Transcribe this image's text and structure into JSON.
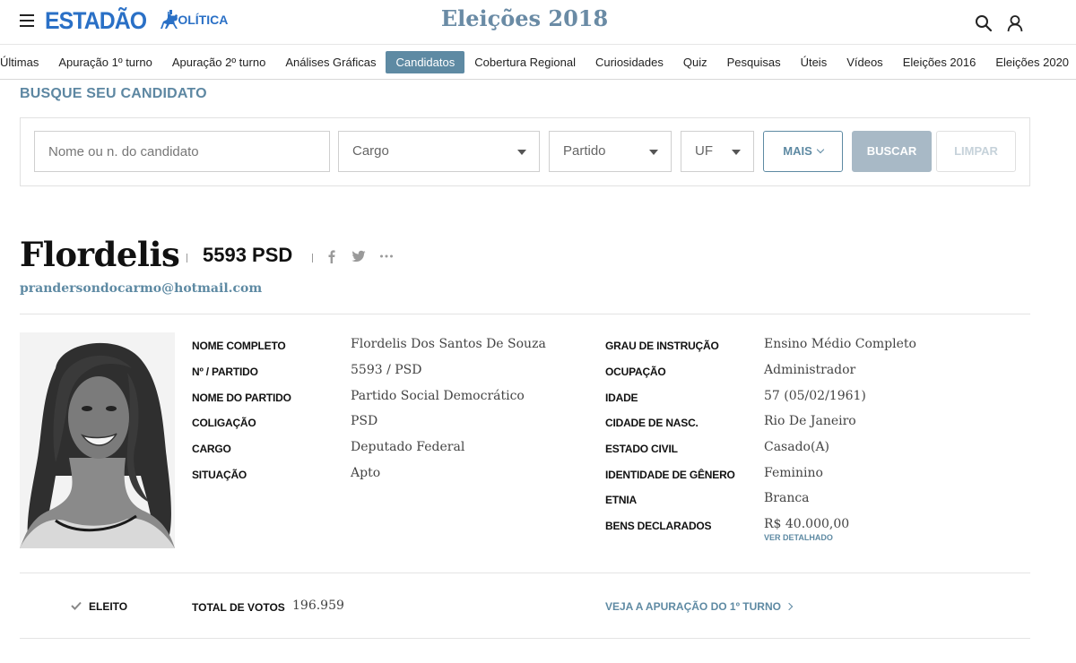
{
  "header": {
    "logo_text": "ESTADÃO",
    "section": "POLÍTICA",
    "title": "Eleições 2018",
    "icons": [
      "menu-icon",
      "horse-rider-logo-icon",
      "search-icon",
      "user-icon"
    ]
  },
  "nav": {
    "items": [
      {
        "label": "Últimas"
      },
      {
        "label": "Apuração 1º turno"
      },
      {
        "label": "Apuração 2º turno"
      },
      {
        "label": "Análises Gráficas"
      },
      {
        "label": "Candidatos",
        "active": true
      },
      {
        "label": "Cobertura Regional"
      },
      {
        "label": "Curiosidades"
      },
      {
        "label": "Quiz"
      },
      {
        "label": "Pesquisas"
      },
      {
        "label": "Úteis"
      },
      {
        "label": "Vídeos"
      },
      {
        "label": "Eleições 2016"
      },
      {
        "label": "Eleições 2020"
      }
    ]
  },
  "search": {
    "heading": "BUSQUE SEU CANDIDATO",
    "name_placeholder": "Nome ou n. do candidato",
    "name_value": "",
    "cargo": "Cargo",
    "partido": "Partido",
    "uf": "UF",
    "more_label": "MAIS",
    "search_label": "BUSCAR",
    "clear_label": "LIMPAR"
  },
  "candidate": {
    "name": "Flordelis",
    "number_party": "5593 PSD",
    "email": "prandersondocarmo@hotmail.com",
    "share_icons": [
      "facebook-icon",
      "twitter-icon",
      "more-icon"
    ],
    "details_left": [
      {
        "label": "NOME COMPLETO",
        "value": "Flordelis Dos Santos De Souza"
      },
      {
        "label": "Nº / PARTIDO",
        "value": "5593 / PSD"
      },
      {
        "label": "NOME DO PARTIDO",
        "value": "Partido Social Democrático"
      },
      {
        "label": "COLIGAÇÃO",
        "value": "PSD"
      },
      {
        "label": "CARGO",
        "value": "Deputado Federal"
      },
      {
        "label": "SITUAÇÃO",
        "value": "Apto"
      }
    ],
    "details_right": [
      {
        "label": "GRAU DE INSTRUÇÃO",
        "value": "Ensino Médio Completo"
      },
      {
        "label": "OCUPAÇÃO",
        "value": "Administrador"
      },
      {
        "label": "IDADE",
        "value": "57 (05/02/1961)"
      },
      {
        "label": "CIDADE DE NASC.",
        "value": "Rio De Janeiro"
      },
      {
        "label": "ESTADO CIVIL",
        "value": "Casado(A)"
      },
      {
        "label": "IDENTIDADE DE GÊNERO",
        "value": "Feminino"
      },
      {
        "label": "ETNIA",
        "value": "Branca"
      },
      {
        "label": "BENS DECLARADOS",
        "value": "R$ 40.000,00"
      }
    ],
    "assets_link": "VER DETALHADO"
  },
  "result": {
    "status": "ELEITO",
    "total_votes_label": "TOTAL DE VOTOS",
    "total_votes": "196.959",
    "apuracao_link": "VEJA A APURAÇÃO DO 1º TURNO"
  }
}
